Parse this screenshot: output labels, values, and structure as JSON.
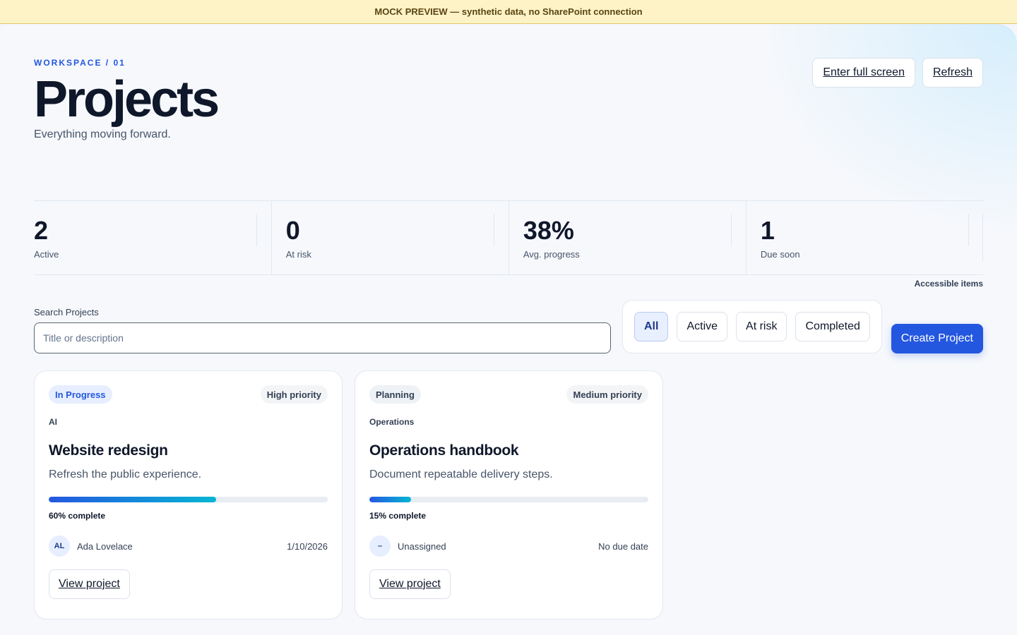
{
  "banner": {
    "text": "MOCK PREVIEW — synthetic data, no SharePoint connection"
  },
  "header": {
    "eyebrow": "WORKSPACE / 01",
    "title": "Projects",
    "subtitle": "Everything moving forward.",
    "fullscreen_label": "Enter full screen",
    "refresh_label": "Refresh"
  },
  "stats": [
    {
      "value": "2",
      "label": "Active"
    },
    {
      "value": "0",
      "label": "At risk"
    },
    {
      "value": "38%",
      "label": "Avg. progress"
    },
    {
      "value": "1",
      "label": "Due soon"
    }
  ],
  "accessible_label": "Accessible items",
  "search": {
    "label": "Search Projects",
    "placeholder": "Title or description",
    "value": ""
  },
  "filters": [
    {
      "label": "All",
      "active": true
    },
    {
      "label": "Active",
      "active": false
    },
    {
      "label": "At risk",
      "active": false
    },
    {
      "label": "Completed",
      "active": false
    }
  ],
  "create_label": "Create Project",
  "colors": {
    "accent": "#2457e0",
    "progress_end": "#06b6d4",
    "banner_bg": "#fef3c7"
  },
  "projects": [
    {
      "status": "In Progress",
      "priority": "High priority",
      "category": "AI",
      "title": "Website redesign",
      "description": "Refresh the public experience.",
      "progress": 60,
      "progress_text": "60% complete",
      "owner_initials": "AL",
      "owner_name": "Ada Lovelace",
      "due": "1/10/2026",
      "view_label": "View project"
    },
    {
      "status": "Planning",
      "priority": "Medium priority",
      "category": "Operations",
      "title": "Operations handbook",
      "description": "Document repeatable delivery steps.",
      "progress": 15,
      "progress_text": "15% complete",
      "owner_initials": "–",
      "owner_name": "Unassigned",
      "due": "No due date",
      "view_label": "View project"
    }
  ]
}
